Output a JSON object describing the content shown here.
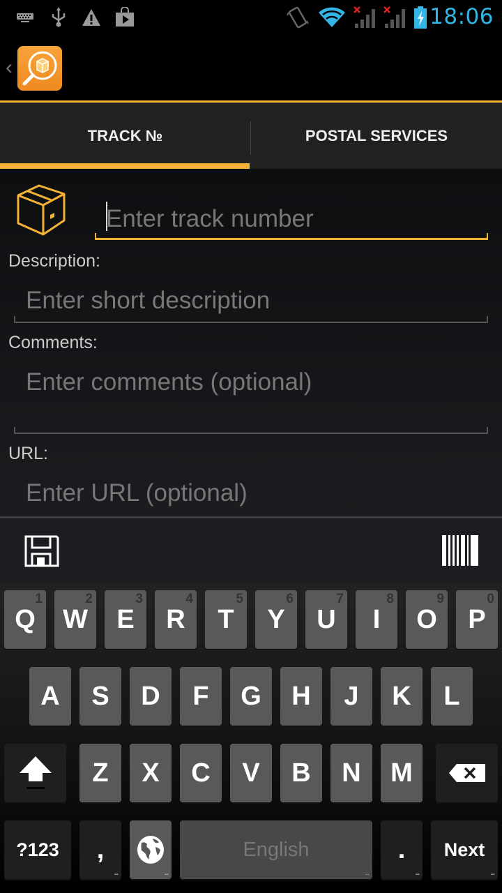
{
  "status_bar": {
    "left_icons": [
      "keyboard-icon",
      "usb-icon",
      "warning-icon",
      "play-store-icon"
    ],
    "right_icons": [
      "vibrate-icon",
      "wifi-icon",
      "signal-no-service-icon",
      "signal-no-service-icon",
      "battery-charging-icon"
    ],
    "time": "18:06",
    "accent_color": "#33b5e5"
  },
  "action_bar": {
    "back_glyph": "‹",
    "app_icon": "package-search-icon"
  },
  "tabs": [
    {
      "label": "TRACK №",
      "active": true
    },
    {
      "label": "POSTAL SERVICES",
      "active": false
    }
  ],
  "accent_color": "#f5b335",
  "form": {
    "track_number": {
      "value": "",
      "placeholder": "Enter track number"
    },
    "description": {
      "label": "Description:",
      "value": "",
      "placeholder": "Enter short description"
    },
    "comments": {
      "label": "Comments:",
      "value": "",
      "placeholder": "Enter comments (optional)"
    },
    "url": {
      "label": "URL:",
      "value": "",
      "placeholder": "Enter URL (optional)"
    }
  },
  "toolbar": {
    "save_icon": "floppy-disk-icon",
    "scan_icon": "barcode-icon"
  },
  "keyboard": {
    "row1": [
      {
        "key": "Q",
        "hint": "1"
      },
      {
        "key": "W",
        "hint": "2"
      },
      {
        "key": "E",
        "hint": "3"
      },
      {
        "key": "R",
        "hint": "4"
      },
      {
        "key": "T",
        "hint": "5"
      },
      {
        "key": "Y",
        "hint": "6"
      },
      {
        "key": "U",
        "hint": "7"
      },
      {
        "key": "I",
        "hint": "8"
      },
      {
        "key": "O",
        "hint": "9"
      },
      {
        "key": "P",
        "hint": "0"
      }
    ],
    "row2": [
      "A",
      "S",
      "D",
      "F",
      "G",
      "H",
      "J",
      "K",
      "L"
    ],
    "row3": [
      "Z",
      "X",
      "C",
      "V",
      "B",
      "N",
      "M"
    ],
    "symbols_label": "?123",
    "comma_label": ",",
    "space_label": "English",
    "period_label": ".",
    "action_label": "Next",
    "more_dots": "..."
  }
}
